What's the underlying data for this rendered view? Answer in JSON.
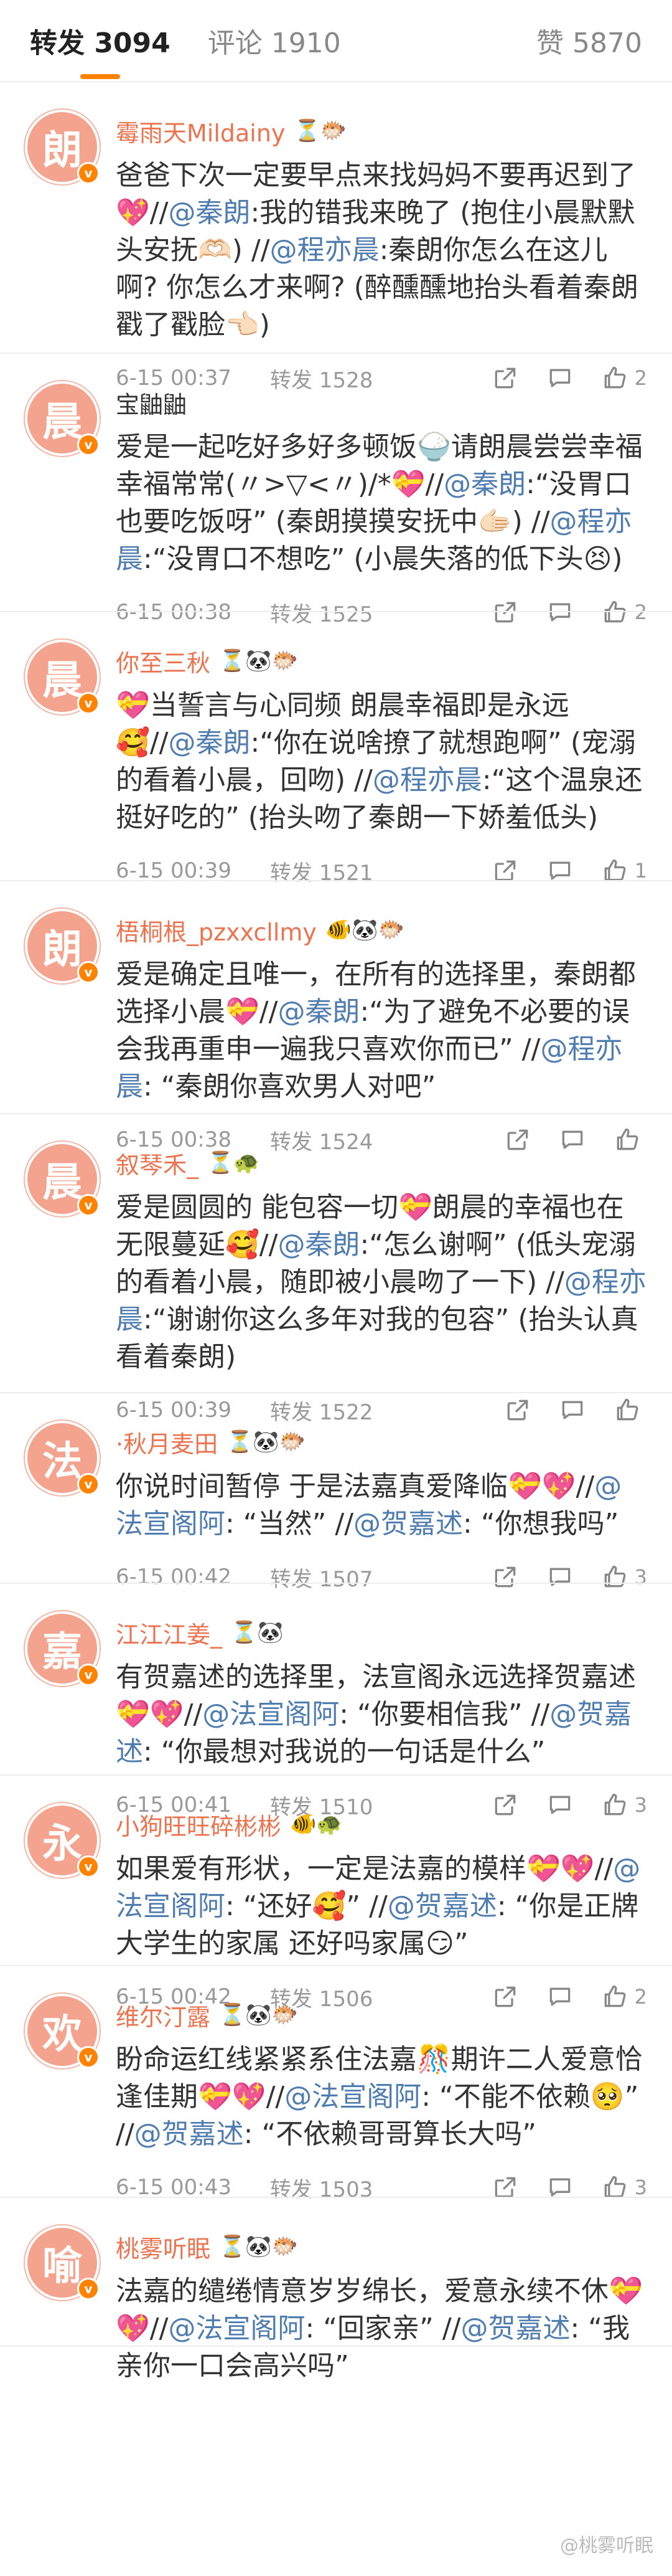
{
  "tabs": {
    "forward": "转发 3094",
    "comment": "评论 1910",
    "like": "赞 5870"
  },
  "items": [
    {
      "user": "霉雨天Mildainy",
      "icons": "⏳🐡",
      "avatar_char": "朗",
      "avatar_color": "#f4a38f",
      "name_colored": true,
      "text": [
        "爸爸下次一定要早点来找妈妈不要再迟到了💖//",
        "@秦朗",
        ":我的错我来晚了 (抱住小晨默默头安抚🫶🏻) //",
        "@程亦晨",
        ":秦朗你怎么在这儿啊? 你怎么才来啊? (醉醺醺地抬头看着秦朗戳了戳脸👈🏻)"
      ],
      "time": "6-15 00:37",
      "reposts": "转发 1528",
      "likes": "2"
    },
    {
      "user": "宝鼬鼬",
      "icons": "",
      "avatar_char": "晨",
      "avatar_color": "#f4a38f",
      "name_colored": false,
      "text": [
        "爱是一起吃好多好多顿饭🍚请朗晨尝尝幸福 幸福常常(〃>▽<〃)/*💝//",
        "@秦朗",
        ":“没胃口也要吃饭呀” (秦朗摸摸安抚中🫱🏻) //",
        "@程亦晨",
        ":“没胃口不想吃” (小晨失落的低下头😣)"
      ],
      "time": "6-15 00:38",
      "reposts": "转发 1525",
      "likes": "2"
    },
    {
      "user": "你至三秋",
      "icons": "⏳🐼🐡",
      "avatar_char": "晨",
      "avatar_color": "#f4a38f",
      "name_colored": true,
      "text": [
        "💝当誓言与心同频 朗晨幸福即是永远🥰//",
        "@秦朗",
        ":“你在说啥撩了就想跑啊” (宠溺的看着小晨，回吻) //",
        "@程亦晨",
        ":“这个温泉还挺好吃的” (抬头吻了秦朗一下娇羞低头)"
      ],
      "time": "6-15 00:39",
      "reposts": "转发 1521",
      "likes": "1"
    },
    {
      "user": "梧桐根_pzxxcllmy",
      "icons": "🐠🐼🐡",
      "avatar_char": "朗",
      "avatar_color": "#f4a38f",
      "name_colored": true,
      "text": [
        "爱是确定且唯一，在所有的选择里，秦朗都选择小晨💝//",
        "@秦朗",
        ":“为了避免不必要的误会我再重申一遍我只喜欢你而已” //",
        "@程亦晨",
        ": “秦朗你喜欢男人对吧”"
      ],
      "time": "6-15 00:38",
      "reposts": "转发 1524",
      "likes": ""
    },
    {
      "user": "叙琴禾_",
      "icons": "⏳🐢",
      "avatar_char": "晨",
      "avatar_color": "#f4a38f",
      "name_colored": true,
      "text": [
        "爱是圆圆的 能包容一切💝朗晨的幸福也在无限蔓延🥰//",
        "@秦朗",
        ":“怎么谢啊” (低头宠溺的看着小晨，随即被小晨吻了一下) //",
        "@程亦晨",
        ":“谢谢你这么多年对我的包容” (抬头认真看着秦朗)"
      ],
      "time": "6-15 00:39",
      "reposts": "转发 1522",
      "likes": ""
    },
    {
      "user": "·秋月麦田",
      "icons": "⏳🐼🐡",
      "avatar_char": "法",
      "avatar_color": "#f4a38f",
      "name_colored": true,
      "text": [
        "你说时间暂停 于是法嘉真爱降临💝💖//",
        "@法宣阁阿",
        ": “当然” //",
        "@贺嘉述",
        ": “你想我吗”"
      ],
      "time": "6-15 00:42",
      "reposts": "转发 1507",
      "likes": "3"
    },
    {
      "user": "江江江姜_",
      "icons": "⏳🐼",
      "avatar_char": "嘉",
      "avatar_color": "#f4a38f",
      "name_colored": true,
      "text": [
        "有贺嘉述的选择里，法宣阁永远选择贺嘉述💝💖//",
        "@法宣阁阿",
        ": “你要相信我” //",
        "@贺嘉述",
        ": “你最想对我说的一句话是什么”"
      ],
      "time": "6-15 00:41",
      "reposts": "转发 1510",
      "likes": "3"
    },
    {
      "user": "小狗旺旺碎彬彬",
      "icons": "🐠🐢",
      "avatar_char": "永",
      "avatar_color": "#f4a38f",
      "name_colored": true,
      "text": [
        "如果爱有形状，一定是法嘉的模样💝💖//",
        "@法宣阁阿",
        ": “还好🥰” //",
        "@贺嘉述",
        ": “你是正牌大学生的家属 还好吗家属😏”"
      ],
      "time": "6-15 00:42",
      "reposts": "转发 1506",
      "likes": "2"
    },
    {
      "user": "维尔汀露",
      "icons": "⏳🐼🐡",
      "avatar_char": "欢",
      "avatar_color": "#f4a38f",
      "name_colored": true,
      "text": [
        "盼命运红线紧紧系住法嘉🎊期许二人爱意恰逢佳期💝💖//",
        "@法宣阁阿",
        ": “不能不依赖🥺” //",
        "@贺嘉述",
        ": “不依赖哥哥算长大吗”"
      ],
      "time": "6-15 00:43",
      "reposts": "转发 1503",
      "likes": "3"
    },
    {
      "user": "桃雾听眠",
      "icons": "⏳🐼🐡",
      "avatar_char": "喻",
      "avatar_color": "#f4a38f",
      "name_colored": true,
      "text": [
        "法嘉的缱绻情意岁岁绵长，爱意永续不休💝💖//",
        "@法宣阁阿",
        ": “回家亲” //",
        "@贺嘉述",
        ": “我亲你一口会高兴吗”"
      ],
      "time": "",
      "reposts": "",
      "likes": ""
    }
  ],
  "watermark": "@桃雾听眠"
}
